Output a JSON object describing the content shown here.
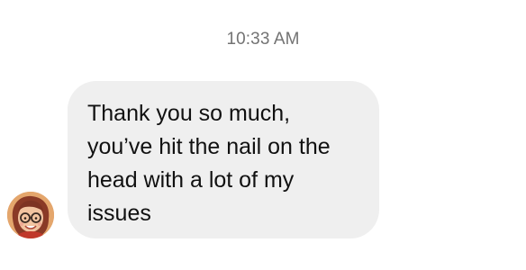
{
  "thread": {
    "timestamp": "10:33 AM"
  },
  "message": {
    "text": "Thank you so much,\nyou’ve hit the nail on the\nhead with a lot of my\nissues",
    "avatar_icon": "profile-avatar"
  },
  "colors": {
    "bubble_background": "#efefef",
    "timestamp_text": "#737373",
    "message_text": "#111111"
  }
}
